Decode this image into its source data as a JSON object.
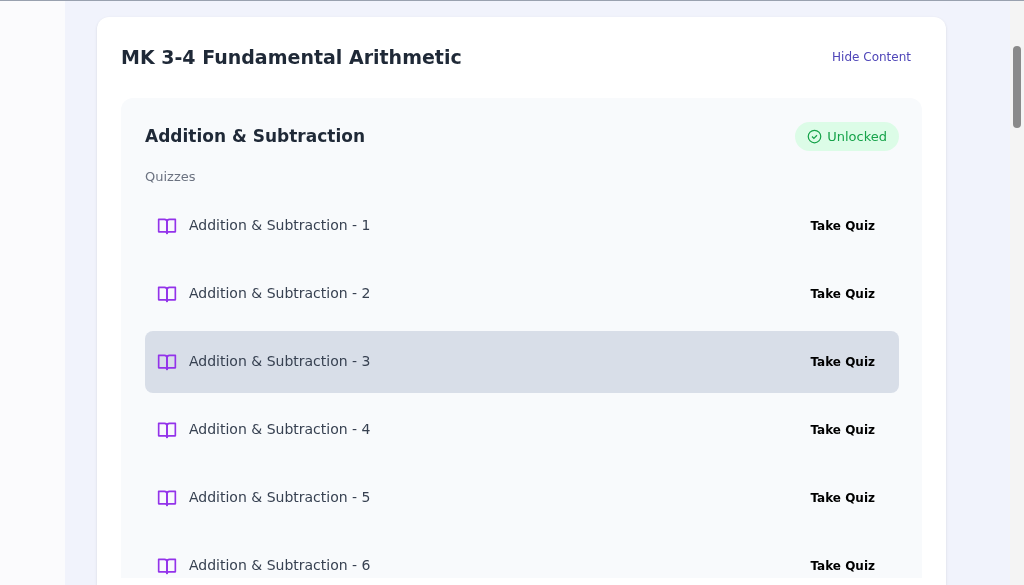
{
  "course": {
    "title": "MK 3-4 Fundamental Arithmetic",
    "toggle": "Hide Content"
  },
  "section": {
    "title": "Addition & Subtraction",
    "status": {
      "kind": "unlocked",
      "label": "Unlocked"
    },
    "group_label": "Quizzes",
    "quizzes": [
      {
        "title": "Addition & Subtraction - 1",
        "action": "Take Quiz",
        "highlighted": false
      },
      {
        "title": "Addition & Subtraction - 2",
        "action": "Take Quiz",
        "highlighted": false
      },
      {
        "title": "Addition & Subtraction - 3",
        "action": "Take Quiz",
        "highlighted": true
      },
      {
        "title": "Addition & Subtraction - 4",
        "action": "Take Quiz",
        "highlighted": false
      },
      {
        "title": "Addition & Subtraction - 5",
        "action": "Take Quiz",
        "highlighted": false
      },
      {
        "title": "Addition & Subtraction - 6",
        "action": "Take Quiz",
        "highlighted": false
      }
    ]
  }
}
